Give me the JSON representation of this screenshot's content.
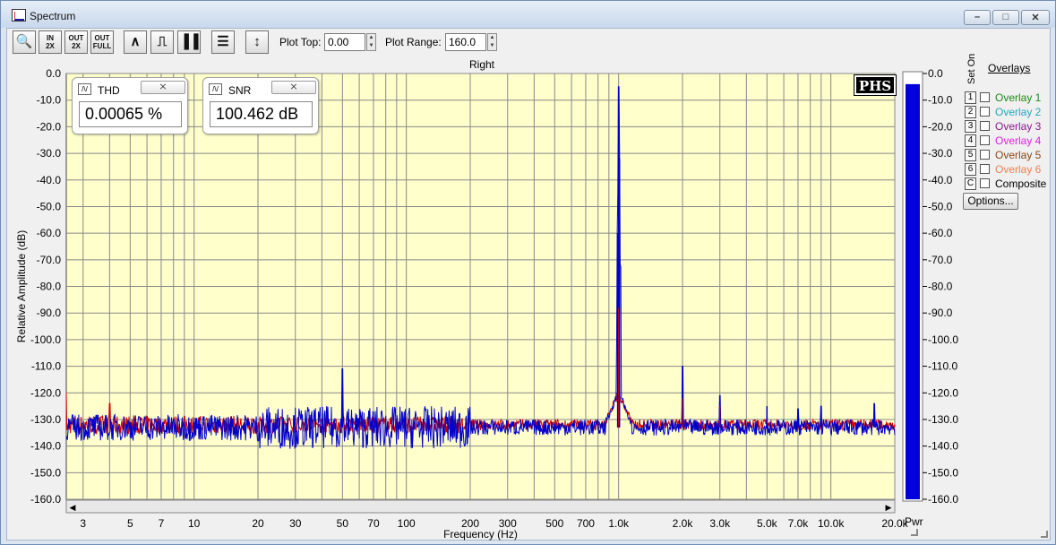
{
  "window": {
    "title": "Spectrum",
    "minimize": "–",
    "maximize": "□",
    "close": "✕"
  },
  "toolbar": {
    "buttons": [
      {
        "name": "zoom-icon",
        "glyph": "🔍"
      },
      {
        "name": "zoom-in-2x-icon",
        "glyph": "IN\n2X"
      },
      {
        "name": "zoom-out-2x-icon",
        "glyph": "OUT\n2X"
      },
      {
        "name": "zoom-out-full-icon",
        "glyph": "OUT\nFULL"
      },
      {
        "name": "line-graph-icon",
        "glyph": "∧"
      },
      {
        "name": "step-graph-icon",
        "glyph": "⎍"
      },
      {
        "name": "bar-graph-icon",
        "glyph": "▐▐"
      },
      {
        "name": "table-icon",
        "glyph": "☰"
      },
      {
        "name": "vertical-resize-icon",
        "glyph": "↕"
      }
    ],
    "plot_top_label": "Plot Top:",
    "plot_top_value": "0.00",
    "plot_range_label": "Plot Range:",
    "plot_range_value": "160.0"
  },
  "meters": {
    "thd": {
      "label": "THD",
      "value": "0.00065 %",
      "close": "⨯"
    },
    "snr": {
      "label": "SNR",
      "value": "100.462 dB",
      "close": "⨯"
    }
  },
  "logo": "PHS",
  "overlays": {
    "title": "Overlays",
    "set_on_label": "Set On",
    "items": [
      {
        "num": "1",
        "label": "Overlay 1",
        "color": "#1d8a1d"
      },
      {
        "num": "2",
        "label": "Overlay 2",
        "color": "#22a8b8"
      },
      {
        "num": "3",
        "label": "Overlay 3",
        "color": "#8b1a8b"
      },
      {
        "num": "4",
        "label": "Overlay 4",
        "color": "#e020e0"
      },
      {
        "num": "5",
        "label": "Overlay 5",
        "color": "#8b4513"
      },
      {
        "num": "6",
        "label": "Overlay 6",
        "color": "#f08050"
      },
      {
        "num": "C",
        "label": "Composite",
        "color": "#000000"
      }
    ],
    "options_button": "Options..."
  },
  "power_label": "Pwr",
  "colors": {
    "plot_bg": "#ffffcc",
    "grid": "#888888",
    "series_blue": "#0000cc",
    "series_red": "#cc0000",
    "bar_fill": "#0000dd"
  },
  "chart_data": {
    "type": "line",
    "title": "Right",
    "xlabel": "Frequency (Hz)",
    "ylabel": "Relative Amplitude (dB)",
    "x_scale": "log",
    "xlim": [
      2.5,
      20000
    ],
    "ylim": [
      -160,
      0
    ],
    "grid": true,
    "x_ticks": [
      3,
      5,
      7,
      10,
      20,
      30,
      50,
      70,
      100,
      200,
      300,
      500,
      700,
      1000,
      2000,
      3000,
      5000,
      7000,
      10000,
      20000
    ],
    "x_tick_labels": [
      "3",
      "5",
      "7",
      "10",
      "20",
      "30",
      "50",
      "70",
      "100",
      "200",
      "300",
      "500",
      "700",
      "1.0k",
      "2.0k",
      "3.0k",
      "5.0k",
      "7.0k",
      "10.0k",
      "20.0k"
    ],
    "y_ticks": [
      0,
      -10,
      -20,
      -30,
      -40,
      -50,
      -60,
      -70,
      -80,
      -90,
      -100,
      -110,
      -120,
      -130,
      -140,
      -150,
      -160
    ],
    "y_tick_labels": [
      "0.0",
      "-10.0",
      "-20.0",
      "-30.0",
      "-40.0",
      "-50.0",
      "-60.0",
      "-70.0",
      "-80.0",
      "-90.0",
      "-100.0",
      "-110.0",
      "-120.0",
      "-130.0",
      "-140.0",
      "-150.0",
      "-160.0"
    ],
    "noise_floor_db": -133,
    "series": [
      {
        "color": "#0000cc",
        "peaks": [
          {
            "x": 1000,
            "y": -5
          },
          {
            "x": 1010,
            "y": -32
          },
          {
            "x": 990,
            "y": -60
          },
          {
            "x": 50,
            "y": -111
          },
          {
            "x": 2000,
            "y": -110
          },
          {
            "x": 3000,
            "y": -121
          },
          {
            "x": 5000,
            "y": -125
          },
          {
            "x": 7000,
            "y": -126
          },
          {
            "x": 9000,
            "y": -125
          },
          {
            "x": 16000,
            "y": -124
          }
        ]
      },
      {
        "color": "#cc0000",
        "peaks": [
          {
            "x": 1000,
            "y": -88
          },
          {
            "x": 2.5,
            "y": -120
          },
          {
            "x": 4,
            "y": -124
          },
          {
            "x": 2000,
            "y": -122
          },
          {
            "x": 3000,
            "y": -125
          }
        ]
      }
    ],
    "level_meter": {
      "label": "Pwr",
      "value_db": -4,
      "ylim": [
        -160,
        0
      ]
    }
  }
}
